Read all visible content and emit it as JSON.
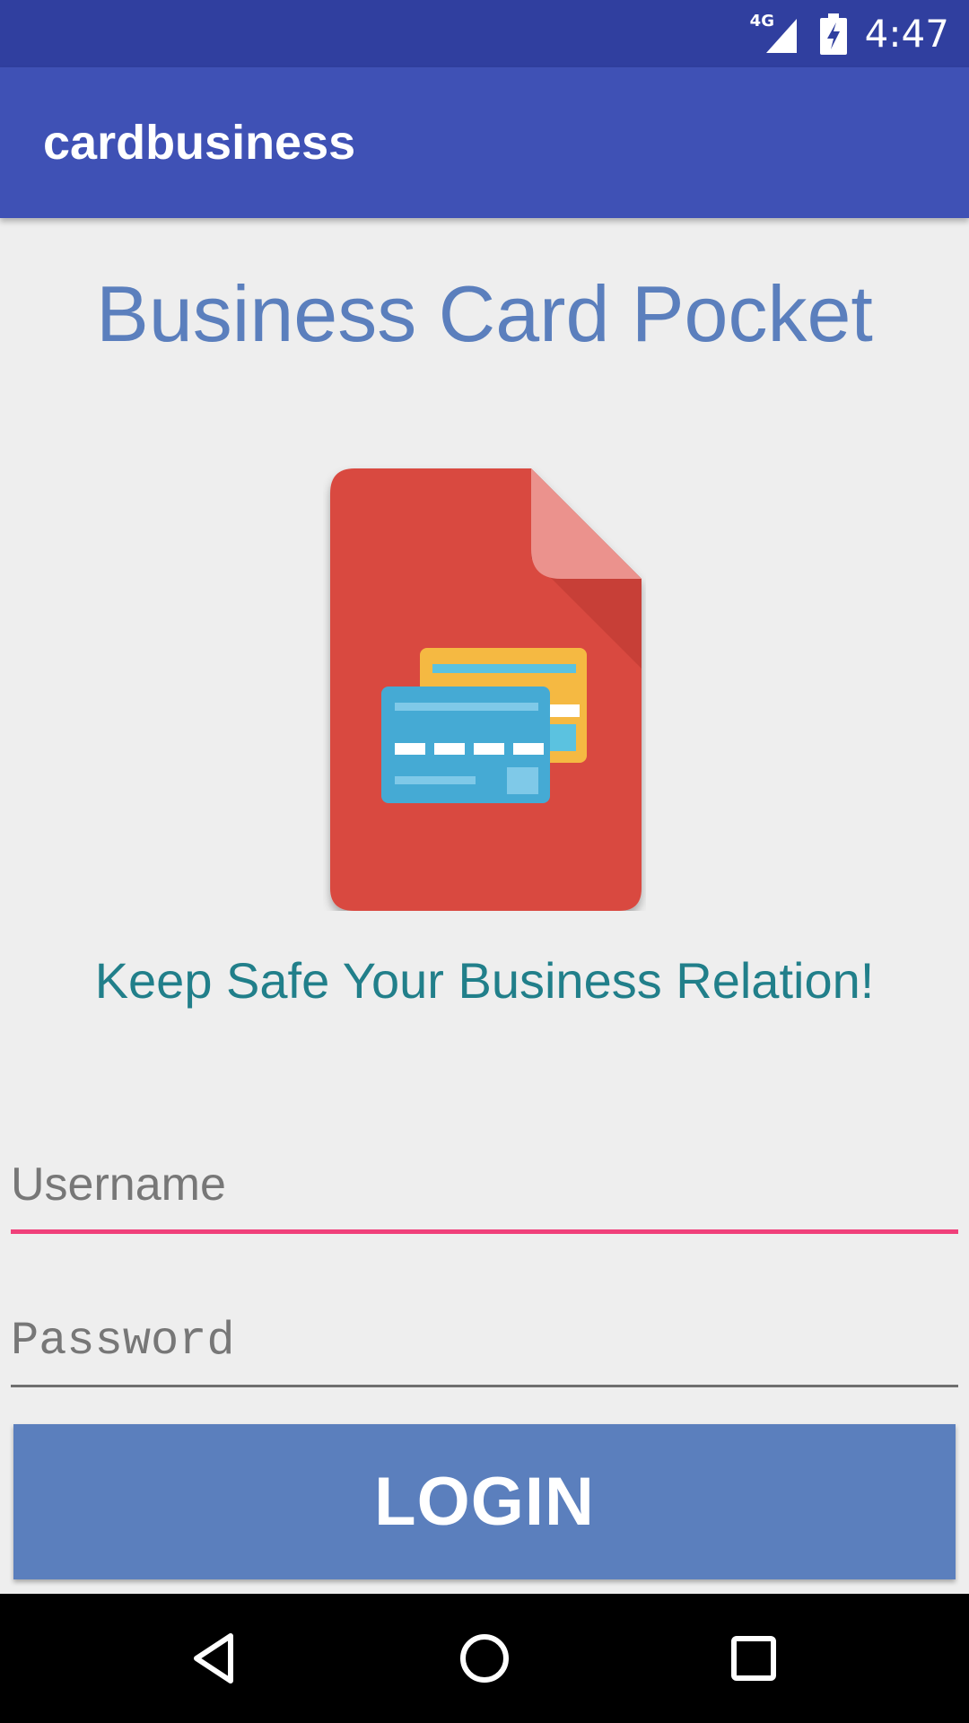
{
  "status_bar": {
    "network_label": "4G",
    "time": "4:47",
    "icons": [
      "signal-icon",
      "battery-charging-icon"
    ]
  },
  "app_bar": {
    "title": "cardbusiness"
  },
  "main": {
    "headline": "Business Card Pocket",
    "hero_image": "business-card-document-icon",
    "tagline": "Keep Safe Your Business Relation!",
    "username": {
      "value": "",
      "placeholder": "Username"
    },
    "password": {
      "value": "",
      "placeholder": "Password"
    },
    "login_label": "LOGIN"
  },
  "nav_bar": {
    "icons": [
      "back-icon",
      "home-icon",
      "recents-icon"
    ]
  },
  "colors": {
    "status_bar": "#303f9f",
    "app_bar": "#3f51b5",
    "headline": "#5b7fbd",
    "tagline": "#217f8a",
    "accent": "#f0407a",
    "button": "#5b7fbd",
    "document": "#d9483f",
    "card_front": "#45aad4",
    "card_back": "#f5b942"
  }
}
